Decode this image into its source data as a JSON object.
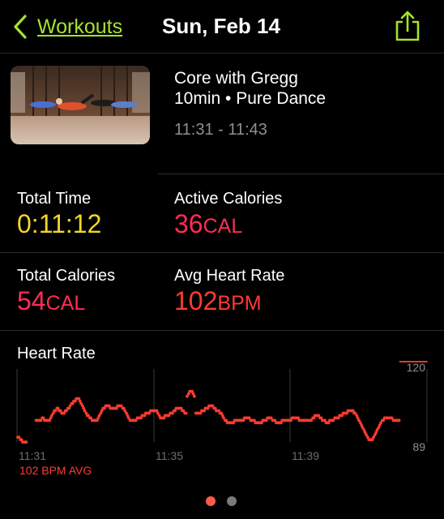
{
  "nav": {
    "back_label": "Workouts",
    "title": "Sun, Feb 14"
  },
  "workout": {
    "name": "Core with Gregg",
    "meta": "10min • Pure Dance",
    "time_range": "11:31 - 11:43"
  },
  "metrics": {
    "total_time": {
      "label": "Total Time",
      "value": "0:11:12"
    },
    "active_calories": {
      "label": "Active Calories",
      "value": "36",
      "unit": "CAL"
    },
    "total_calories": {
      "label": "Total Calories",
      "value": "54",
      "unit": "CAL"
    },
    "avg_heart_rate": {
      "label": "Avg Heart Rate",
      "value": "102",
      "unit": "BPM"
    }
  },
  "heart_rate": {
    "title": "Heart Rate",
    "avg_label": "102 BPM AVG"
  },
  "colors": {
    "accent_green": "#a6e22e",
    "time_yellow": "#f2d52c",
    "calorie_pink": "#ff2d55",
    "heart_red": "#ff3b30"
  },
  "pagination": {
    "count": 2,
    "current": 1
  },
  "chart_data": {
    "type": "scatter",
    "title": "Heart Rate",
    "xlabel": "",
    "ylabel": "",
    "x_ticks": [
      "11:31",
      "11:35",
      "11:39"
    ],
    "y_ticks": [
      89,
      120
    ],
    "ylim": [
      89,
      120
    ],
    "avg": 102,
    "x": [
      0,
      0.03,
      0.07,
      0.1,
      0.13,
      0.17,
      0.2,
      0.23,
      0.5,
      0.53,
      0.57,
      0.6,
      0.63,
      0.67,
      0.7,
      0.73,
      0.77,
      0.8,
      0.83,
      0.87,
      0.9,
      0.93,
      0.97,
      1.0,
      1.03,
      1.07,
      1.1,
      1.13,
      1.17,
      1.2,
      1.23,
      1.27,
      1.3,
      1.33,
      1.37,
      1.4,
      1.43,
      1.47,
      1.5,
      1.53,
      1.57,
      1.6,
      1.63,
      1.67,
      1.7,
      1.73,
      1.77,
      1.8,
      1.83,
      1.87,
      1.9,
      1.93,
      1.97,
      2.0,
      2.03,
      2.07,
      2.1,
      2.13,
      2.17,
      2.2,
      2.23,
      2.27,
      2.3,
      2.33,
      2.37,
      2.4,
      2.43,
      2.47,
      2.5,
      2.53,
      2.57,
      2.6,
      2.63,
      2.67,
      2.7,
      2.73,
      2.77,
      2.8,
      2.83,
      2.87,
      2.9,
      2.93,
      2.97,
      3.0,
      3.03,
      3.07,
      3.1,
      3.13,
      3.17,
      3.2,
      3.23,
      3.27,
      3.3,
      3.33,
      3.37,
      3.4,
      3.43,
      3.47,
      3.5,
      3.53,
      3.57,
      3.6,
      3.63,
      3.67,
      3.7,
      3.73,
      3.77,
      3.8,
      3.83,
      3.87,
      3.9,
      3.93,
      3.97,
      4.0,
      4.03,
      4.07,
      4.1,
      4.13,
      4.17,
      4.2,
      4.23,
      4.27,
      4.3,
      4.33,
      4.37,
      4.4,
      4.43,
      4.47,
      4.5,
      4.53,
      4.57,
      4.6,
      4.63,
      4.67,
      4.7,
      4.73,
      4.77,
      4.8,
      4.83,
      4.87,
      4.9,
      4.93,
      4.97,
      5.0,
      5.03,
      5.07,
      5.1,
      5.13,
      5.17,
      5.2,
      5.23,
      5.27,
      5.3,
      5.33,
      5.37,
      5.4,
      5.43,
      5.47,
      5.5,
      5.53,
      5.57,
      5.6,
      5.63,
      5.67,
      5.7,
      5.73,
      5.77,
      5.8,
      5.83,
      5.87,
      5.9,
      5.93,
      5.97,
      6.0,
      6.03,
      6.07,
      6.1,
      6.13,
      6.17,
      6.2,
      6.23,
      6.27,
      6.3,
      6.33,
      6.37,
      6.4,
      6.43,
      6.47,
      6.5,
      6.53,
      6.57,
      6.6,
      6.63,
      6.67,
      6.7,
      6.73,
      6.77,
      6.8,
      6.83,
      6.87,
      6.9,
      6.93,
      6.97,
      7.0,
      7.03,
      7.07,
      7.1,
      7.13,
      7.17,
      7.2,
      7.23,
      7.27,
      7.3,
      7.33,
      7.37,
      7.4,
      7.43,
      7.47,
      7.5,
      7.53,
      7.57,
      7.6,
      7.63,
      7.67,
      7.7,
      7.73,
      7.77,
      7.8,
      7.83,
      7.87,
      7.9,
      7.93,
      7.97,
      8.0,
      8.03,
      8.07,
      8.1,
      8.13,
      8.17,
      8.2,
      8.23,
      8.27,
      8.3,
      8.33,
      8.37,
      8.4,
      8.43,
      8.47,
      8.5,
      8.53,
      8.57,
      8.6,
      8.63,
      8.67,
      8.7,
      8.73,
      8.77,
      8.8,
      8.83,
      8.87,
      8.9,
      8.93,
      8.97,
      9.0,
      9.03,
      9.07,
      9.1,
      9.13,
      9.17,
      9.2,
      9.23,
      9.27,
      9.3,
      9.33,
      9.37,
      9.4,
      9.43,
      9.47,
      9.5,
      9.53,
      9.57,
      9.6,
      9.63,
      9.67,
      9.7,
      9.73,
      9.77,
      9.8,
      9.83,
      9.87,
      9.9,
      9.93,
      9.97,
      10.0,
      10.03,
      10.07,
      10.1,
      10.13,
      10.17,
      10.2,
      10.23,
      10.27,
      10.3,
      10.33,
      10.37,
      10.4,
      10.43,
      10.47,
      10.5,
      10.53,
      10.57,
      10.6,
      10.63,
      10.67,
      10.7,
      10.73,
      10.77,
      10.8,
      10.83,
      10.87,
      10.9,
      10.93,
      10.97,
      11.0,
      11.03,
      11.07,
      11.1,
      11.13,
      11.17
    ],
    "values": [
      93,
      93,
      92,
      92,
      91,
      91,
      91,
      91,
      100,
      100,
      100,
      100,
      100,
      101,
      101,
      100,
      100,
      100,
      100,
      100,
      101,
      102,
      103,
      104,
      104,
      105,
      105,
      104,
      104,
      103,
      103,
      103,
      104,
      104,
      105,
      105,
      106,
      107,
      107,
      108,
      108,
      109,
      109,
      109,
      108,
      107,
      106,
      105,
      104,
      103,
      102,
      102,
      101,
      101,
      100,
      100,
      100,
      100,
      100,
      101,
      102,
      103,
      104,
      105,
      105,
      106,
      106,
      106,
      106,
      105,
      105,
      105,
      105,
      105,
      105,
      106,
      106,
      106,
      106,
      105,
      105,
      104,
      103,
      102,
      101,
      100,
      100,
      100,
      100,
      100,
      100,
      101,
      101,
      101,
      101,
      102,
      102,
      102,
      103,
      103,
      103,
      103,
      104,
      104,
      104,
      104,
      104,
      104,
      103,
      102,
      101,
      101,
      101,
      101,
      102,
      102,
      102,
      102,
      103,
      103,
      103,
      104,
      104,
      105,
      105,
      105,
      105,
      105,
      104,
      104,
      103,
      103,
      110,
      111,
      112,
      112,
      112,
      111,
      110,
      103,
      103,
      103,
      103,
      103,
      104,
      104,
      104,
      105,
      105,
      105,
      106,
      106,
      106,
      106,
      105,
      105,
      104,
      104,
      104,
      103,
      103,
      102,
      101,
      100,
      100,
      99,
      99,
      99,
      99,
      99,
      99,
      100,
      100,
      100,
      100,
      100,
      100,
      100,
      100,
      101,
      101,
      101,
      101,
      101,
      100,
      100,
      100,
      100,
      99,
      99,
      99,
      99,
      99,
      99,
      100,
      100,
      100,
      100,
      101,
      101,
      101,
      101,
      100,
      100,
      100,
      99,
      99,
      99,
      99,
      99,
      100,
      100,
      100,
      100,
      100,
      100,
      100,
      100,
      101,
      101,
      101,
      101,
      101,
      101,
      100,
      100,
      100,
      100,
      100,
      100,
      100,
      100,
      100,
      100,
      100,
      101,
      101,
      102,
      102,
      102,
      102,
      101,
      101,
      100,
      100,
      100,
      99,
      99,
      99,
      100,
      100,
      100,
      100,
      101,
      101,
      101,
      101,
      102,
      102,
      102,
      103,
      103,
      103,
      103,
      104,
      104,
      104,
      104,
      104,
      103,
      103,
      102,
      101,
      100,
      99,
      98,
      97,
      96,
      95,
      94,
      93,
      92,
      92,
      92,
      92,
      93,
      94,
      95,
      96,
      97,
      98,
      99,
      100,
      100,
      101,
      101,
      101,
      101,
      101,
      101,
      101,
      100,
      100,
      100,
      100,
      100,
      100
    ]
  }
}
